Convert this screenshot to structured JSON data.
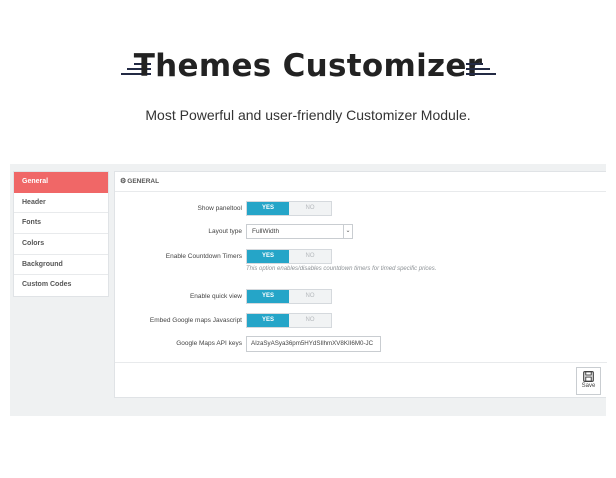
{
  "hero": {
    "title": "Themes Customizer",
    "subtitle": "Most Powerful and user-friendly Customizer Module."
  },
  "sidebar": {
    "items": [
      {
        "label": "General",
        "active": true
      },
      {
        "label": "Header"
      },
      {
        "label": "Fonts"
      },
      {
        "label": "Colors"
      },
      {
        "label": "Background"
      },
      {
        "label": "Custom Codes"
      }
    ]
  },
  "panel": {
    "header": "GENERAL",
    "header_icon": "gear-icon",
    "fields": {
      "show_paneltool": {
        "label": "Show paneltool",
        "yes": "YES",
        "no": "NO",
        "value": "YES"
      },
      "layout_type": {
        "label": "Layout type",
        "value": "FullWidth"
      },
      "countdown": {
        "label": "Enable Countdown Timers",
        "yes": "YES",
        "no": "NO",
        "value": "YES",
        "hint": "This option enables/disables countdown timers for timed specific prices."
      },
      "quick_view": {
        "label": "Enable quick view",
        "yes": "YES",
        "no": "NO",
        "value": "YES"
      },
      "google_maps_js": {
        "label": "Embed Google maps Javascript",
        "yes": "YES",
        "no": "NO",
        "value": "YES"
      },
      "google_maps_key": {
        "label": "Google Maps API keys",
        "value": "AIzaSyASya36pm5HYdSIlhmXV8KII6M0-JC"
      }
    },
    "save_label": "Save"
  },
  "colors": {
    "accent": "#25a5c8",
    "active_tab": "#f06767"
  }
}
